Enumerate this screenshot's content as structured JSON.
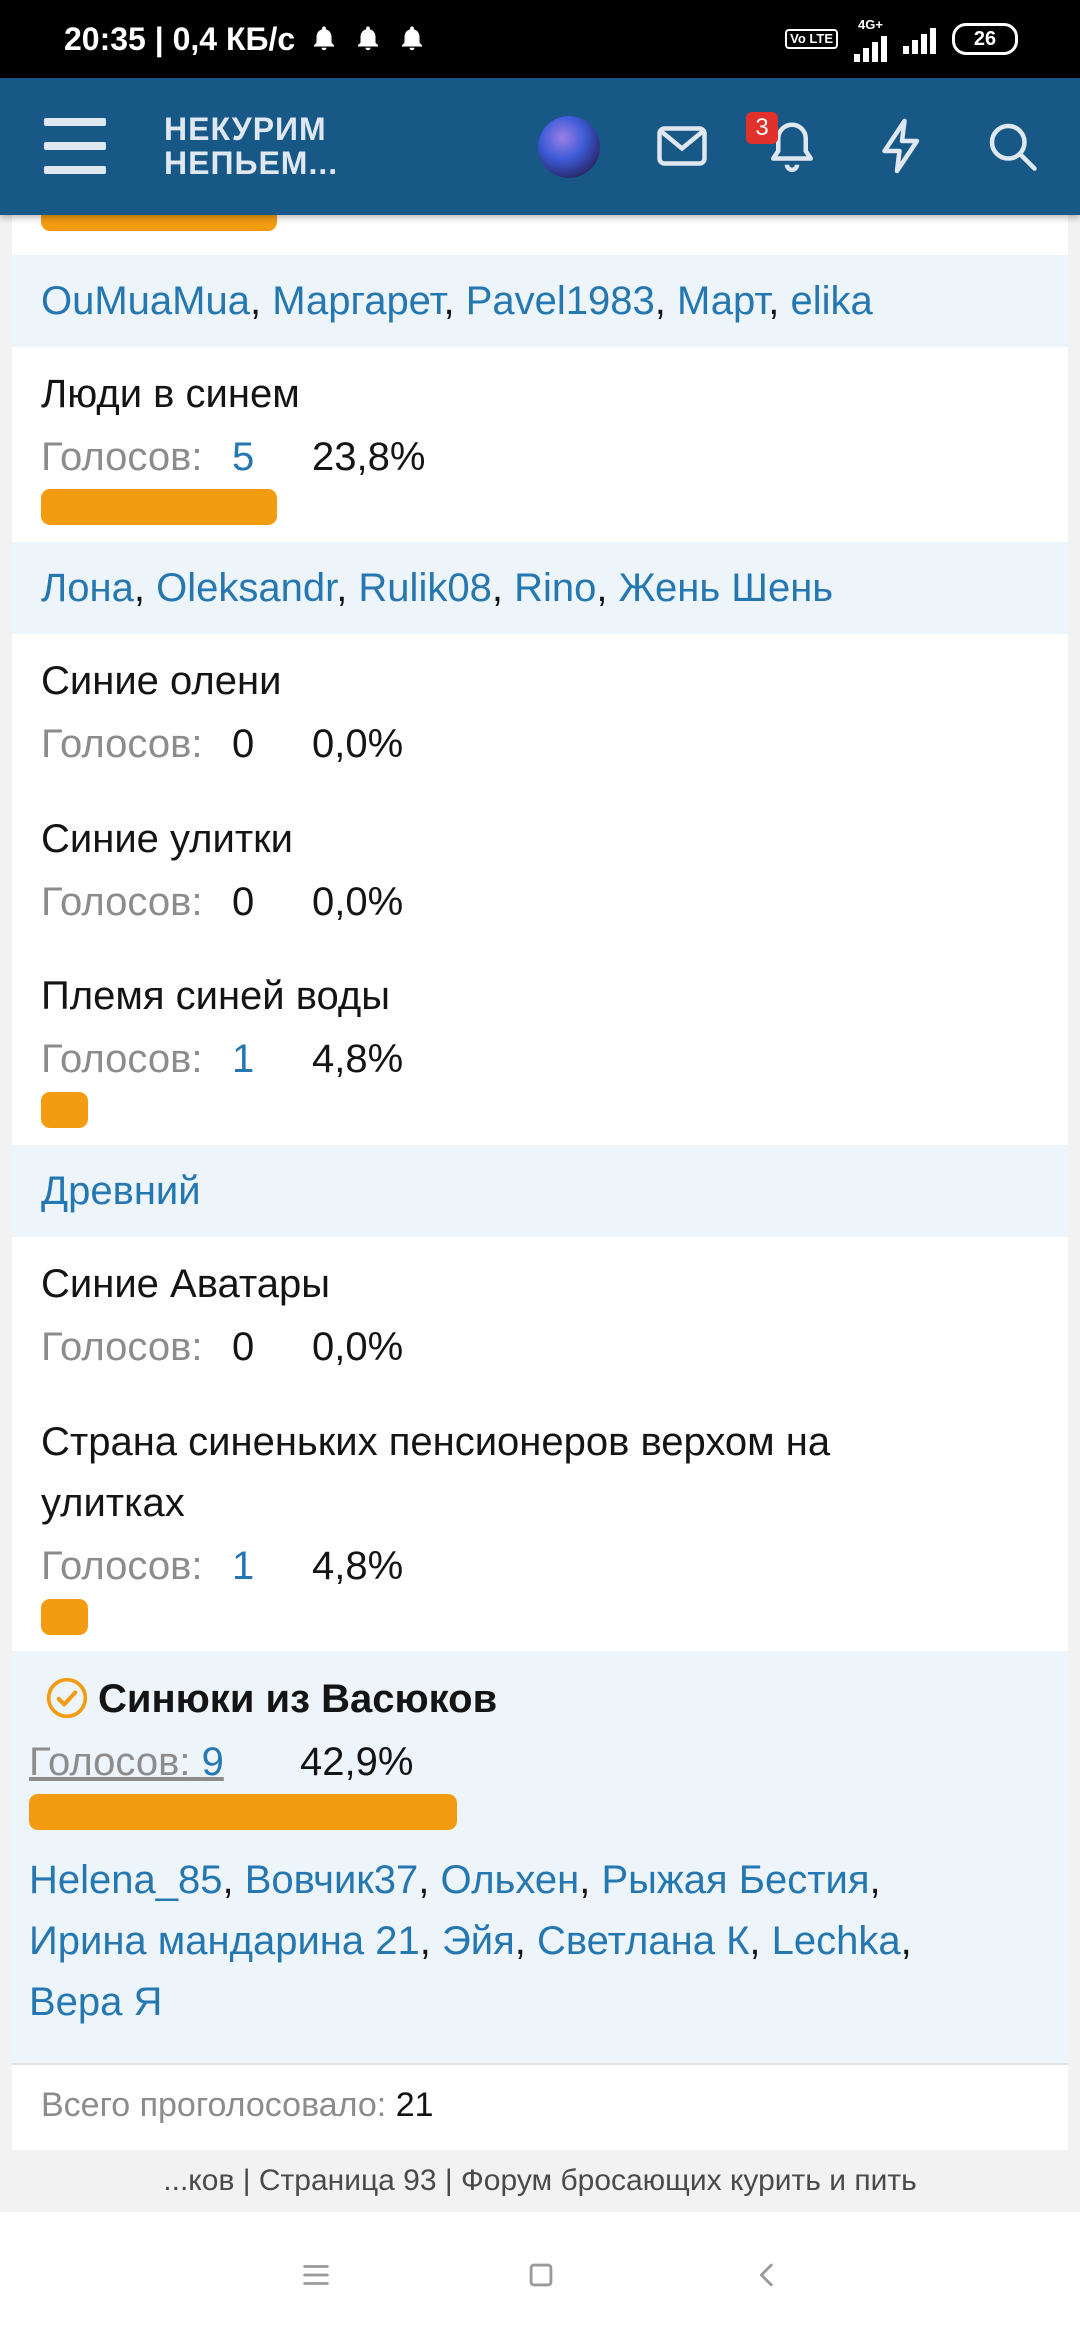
{
  "status_bar": {
    "time_speed": "20:35 | 0,4 КБ/с",
    "volte": "Vo LTE",
    "network": "4G+",
    "battery": "26"
  },
  "header": {
    "logo_line1": "НЕКУРИМ",
    "logo_line2": "НЕПЬЕМ...",
    "notifications_count": "3"
  },
  "poll": {
    "votes_label": "Голосов:",
    "options": [
      {
        "voters": [
          "OuMuaMua",
          "Маргарет",
          "Pavel1983",
          "Март",
          "elika"
        ]
      },
      {
        "name": "Люди в синем",
        "votes": "5",
        "percent": "23,8%",
        "bar_fraction": 0.238,
        "voters": [
          "Лона",
          "Oleksandr",
          "Rulik08",
          "Rino",
          "Жень Шень"
        ]
      },
      {
        "name": "Синие олени",
        "votes": "0",
        "percent": "0,0%",
        "bar_fraction": 0
      },
      {
        "name": "Синие улитки",
        "votes": "0",
        "percent": "0,0%",
        "bar_fraction": 0
      },
      {
        "name": "Племя синей воды",
        "votes": "1",
        "percent": "4,8%",
        "bar_fraction": 0.048,
        "voters": [
          "Древний"
        ]
      },
      {
        "name": "Синие Аватары",
        "votes": "0",
        "percent": "0,0%",
        "bar_fraction": 0
      },
      {
        "name_line1": "Страна синеньких пенсионеров верхом на",
        "name_line2": "улитках",
        "votes": "1",
        "percent": "4,8%",
        "bar_fraction": 0.048
      },
      {
        "name": "Синюки из Васюков",
        "votes": "9",
        "percent": "42,9%",
        "bar_fraction": 0.429,
        "selected": true,
        "voters_line1": [
          "Helena_85",
          "Вовчик37",
          "Ольхен",
          "Рыжая Бестия"
        ],
        "voters_line2": [
          "Ирина мандарина 21",
          "Эйя",
          "Светлана К",
          "Lechka"
        ],
        "voters_line3": [
          "Вера Я"
        ]
      }
    ],
    "total_label": "Всего проголосовало:",
    "total_value": "21"
  },
  "browser": {
    "page_title": "...ков | Страница 93 | Форум бросающих курить и пить"
  },
  "colors": {
    "header_bg": "#185886",
    "bar": "#f39c12",
    "link": "#2577b1",
    "voter_band": "#edf4fa"
  }
}
